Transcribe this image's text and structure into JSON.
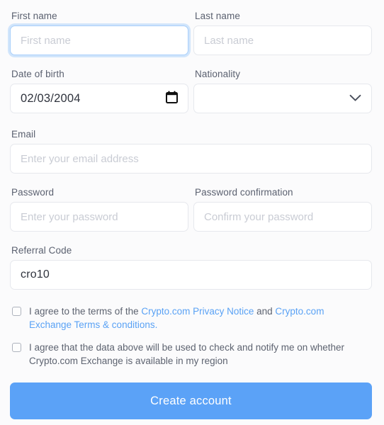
{
  "theme": {
    "page_background": "#f7f8fa",
    "card_background": "#fbfbfc",
    "border": "#e6e8ed",
    "focus_border": "#a8cffb",
    "label_color": "#5b6170",
    "placeholder_color": "#c9ccd4",
    "link_color": "#5aa2f5",
    "button_color": "#5ba2f7",
    "value_color": "#2f333d"
  },
  "form": {
    "first_name": {
      "label": "First name",
      "placeholder": "First name",
      "value": ""
    },
    "last_name": {
      "label": "Last name",
      "placeholder": "Last name",
      "value": ""
    },
    "date_of_birth": {
      "label": "Date of birth",
      "value": "02/03/2004",
      "icon": "calendar-icon"
    },
    "nationality": {
      "label": "Nationality",
      "value": "",
      "icon": "chevron-down-icon"
    },
    "email": {
      "label": "Email",
      "placeholder": "Enter your email address",
      "value": ""
    },
    "password": {
      "label": "Password",
      "placeholder": "Enter your password",
      "value": ""
    },
    "password_confirmation": {
      "label": "Password confirmation",
      "placeholder": "Confirm your password",
      "value": ""
    },
    "referral_code": {
      "label": "Referral Code",
      "placeholder": "",
      "value": "cro10"
    }
  },
  "consents": [
    {
      "checked": false,
      "segments": [
        {
          "type": "text",
          "text": "I agree to the terms of the "
        },
        {
          "type": "link",
          "text": "Crypto.com Privacy Notice"
        },
        {
          "type": "text",
          "text": " and "
        },
        {
          "type": "link",
          "text": "Crypto.com Exchange Terms & conditions."
        }
      ]
    },
    {
      "checked": false,
      "segments": [
        {
          "type": "text",
          "text": "I agree that the data above will be used to check and notify me on whether Crypto.com Exchange is available in my region"
        }
      ]
    }
  ],
  "submit": {
    "label": "Create account"
  }
}
